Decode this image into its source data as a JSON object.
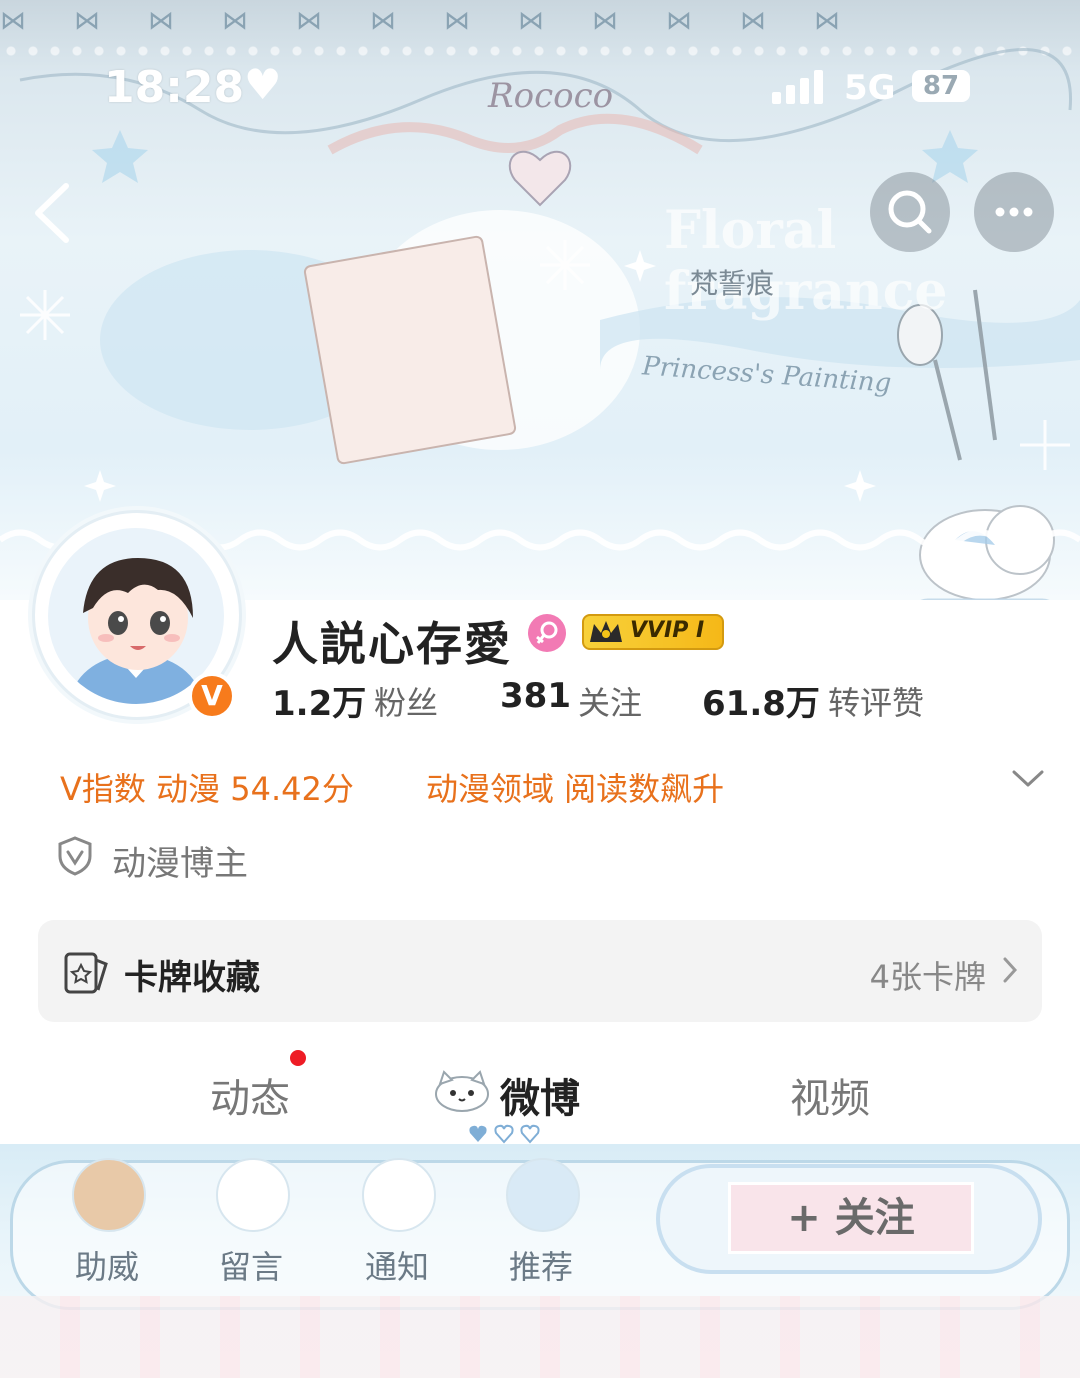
{
  "status_bar": {
    "time": "18:28",
    "network": "5G",
    "battery": "87"
  },
  "header": {
    "decor_text_1": "Rococo",
    "decor_text_2": "Floral fragrance",
    "decor_text_3": "梵誓痕",
    "decor_text_4": "Princess's Painting"
  },
  "profile": {
    "name": "人説心存愛",
    "vip_label": "VVIP I",
    "verified_mark": "V",
    "stats": [
      {
        "num": "1.2万",
        "label": "粉丝"
      },
      {
        "num": "381",
        "label": "关注"
      },
      {
        "num": "61.8万",
        "label": "转评赞"
      }
    ],
    "v_index": "V指数 动漫 54.42分",
    "trend": "动漫领域 阅读数飙升",
    "certification": "动漫博主"
  },
  "card_collection": {
    "title": "卡牌收藏",
    "count": "4张卡牌"
  },
  "tabs": [
    {
      "label": "动态"
    },
    {
      "label": "微博"
    },
    {
      "label": "视频"
    }
  ],
  "toolbar": {
    "items": [
      {
        "label": "助威"
      },
      {
        "label": "留言"
      },
      {
        "label": "通知"
      },
      {
        "label": "推荐"
      }
    ],
    "follow_label": "+ 关注"
  },
  "colors": {
    "accent_orange": "#e8711c",
    "verified_orange": "#f77b1c",
    "vip_gold": "#f5b818",
    "red_dot": "#ee1c25"
  }
}
